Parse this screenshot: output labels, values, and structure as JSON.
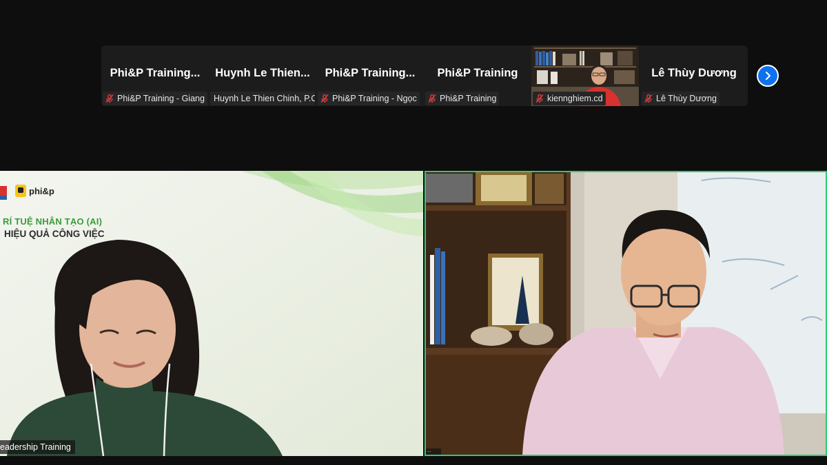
{
  "participant_strip": {
    "tiles": [
      {
        "display_name": "Phi&P Training...",
        "tag": "Phi&P Training - Giang",
        "muted": true
      },
      {
        "display_name": "Huynh Le Thien...",
        "tag": "Huynh Le Thien Chinh, P.C...",
        "muted": false
      },
      {
        "display_name": "Phi&P Training...",
        "tag": "Phi&P Training - Ngọc",
        "muted": true
      },
      {
        "display_name": "Phi&P Training",
        "tag": "Phi&P Training",
        "muted": true
      },
      {
        "display_name": "",
        "tag": "kiennghiem.cd",
        "muted": true,
        "has_video": true
      },
      {
        "display_name": "Lê Thùy Dương",
        "tag": "Lê Thùy Dương",
        "muted": true
      }
    ],
    "next_page_icon": "chevron-right-icon"
  },
  "main_left": {
    "slide_line_1": "RÍ TUỆ NHÂN TẠO (AI)",
    "slide_line_2": "HIỆU QUẢ CÔNG VIỆC",
    "logo_text": "phi&p",
    "name_label": "eadership Training"
  },
  "main_right": {
    "name_label": "...",
    "active_speaker_border": "#2ecc71"
  },
  "colors": {
    "background": "#0e0e0e",
    "tile": "#1c1c1c",
    "accent_blue": "#0e72ed",
    "muted_red": "#e03c3c",
    "slide_green": "#3a9c3a"
  }
}
